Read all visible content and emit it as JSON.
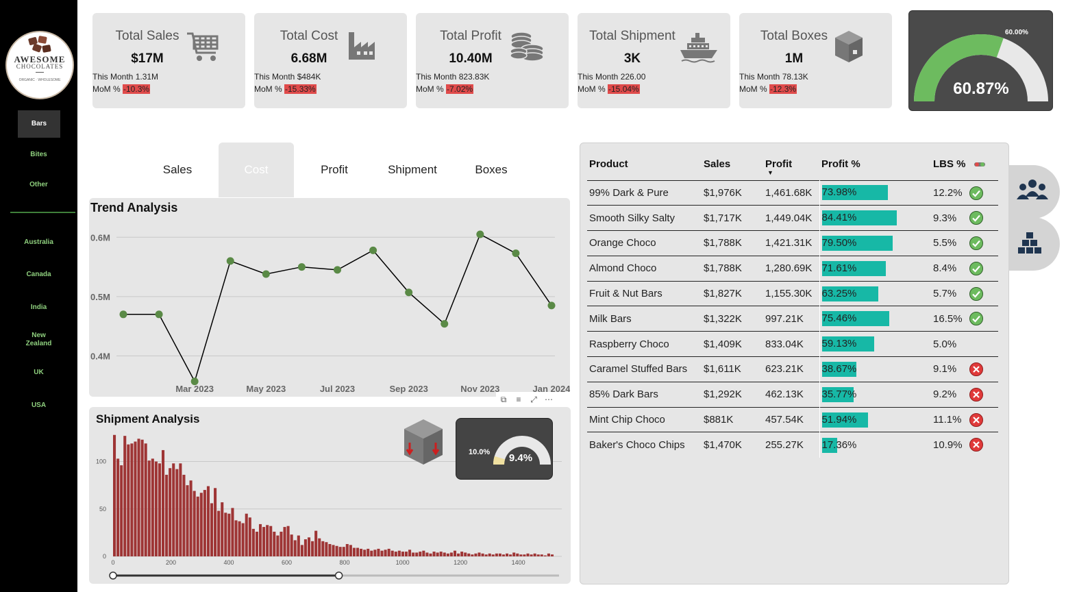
{
  "sidebar": {
    "logo": {
      "title": "AWESOME",
      "subtitle": "CHOCOLATES",
      "tagline": "ORGANIC · WHOLESOME"
    },
    "categories": [
      {
        "label": "Bars",
        "active": true
      },
      {
        "label": "Bites",
        "active": false
      },
      {
        "label": "Other",
        "active": false
      }
    ],
    "countries": [
      "Australia",
      "Canada",
      "India",
      "New Zealand",
      "UK",
      "USA"
    ]
  },
  "kpis": [
    {
      "label": "Total Sales",
      "value": "$17M",
      "month": "This Month 1.31M",
      "mom_label": "MoM %",
      "mom": "-10.3%",
      "icon": "shopping-cart-icon"
    },
    {
      "label": "Total Cost",
      "value": "6.68M",
      "month": "This Month $484K",
      "mom_label": "MoM %",
      "mom": "-15.33%",
      "icon": "factory-icon"
    },
    {
      "label": "Total Profit",
      "value": "10.40M",
      "month": "This Month 823.83K",
      "mom_label": "MoM %",
      "mom": "-7.02%",
      "icon": "coins-icon"
    },
    {
      "label": "Total Shipment",
      "value": "3K",
      "month": "This Month 226.00",
      "mom_label": "MoM %",
      "mom": "-15.04%",
      "icon": "ship-icon"
    },
    {
      "label": "Total Boxes",
      "value": "1M",
      "month": "This Month 78.13K",
      "mom_label": "MoM %",
      "mom": "-12.3%",
      "icon": "box-icon"
    }
  ],
  "profit_gauge": {
    "value_text": "60.87%",
    "target_text": "60.00%",
    "value": 0.6087,
    "target": 0.6
  },
  "tabs": [
    {
      "label": "Sales",
      "active": false
    },
    {
      "label": "Cost",
      "active": true
    },
    {
      "label": "Profit",
      "active": false
    },
    {
      "label": "Shipment",
      "active": false
    },
    {
      "label": "Boxes",
      "active": false
    }
  ],
  "visual_tools": [
    "⧉",
    "≡",
    "⤢",
    "⋯"
  ],
  "chart_data": [
    {
      "type": "line",
      "title": "Trend Analysis",
      "x": [
        "2023-01",
        "2023-02",
        "2023-03",
        "2023-04",
        "2023-05",
        "2023-06",
        "2023-07",
        "2023-08",
        "2023-09",
        "2023-10",
        "2023-11",
        "2023-12",
        "2024-01",
        "2024-02"
      ],
      "values": [
        0.47,
        0.47,
        0.357,
        0.56,
        0.538,
        0.55,
        0.545,
        0.578,
        0.507,
        0.454,
        0.605,
        0.573,
        0.485
      ],
      "x_ticks": [
        "Mar 2023",
        "May 2023",
        "Jul 2023",
        "Sep 2023",
        "Nov 2023",
        "Jan 2024"
      ],
      "y_ticks": [
        "0.4M",
        "0.5M",
        "0.6M"
      ],
      "ylim": [
        0.36,
        0.62
      ],
      "grid": true,
      "color": "#5a8a46"
    },
    {
      "type": "bar",
      "title": "Shipment Analysis",
      "x_ticks": [
        "0",
        "200",
        "400",
        "600",
        "800",
        "1000",
        "1200",
        "1400"
      ],
      "y_ticks": [
        "0",
        "50",
        "100"
      ],
      "xlim": [
        0,
        1550
      ],
      "ylim": [
        0,
        130
      ],
      "bin_width": 12,
      "values": [
        128,
        103,
        96,
        127,
        118,
        119,
        121,
        124,
        123,
        119,
        101,
        103,
        100,
        98,
        112,
        86,
        93,
        98,
        92,
        98,
        86,
        75,
        80,
        69,
        63,
        67,
        70,
        74,
        56,
        72,
        48,
        57,
        46,
        45,
        51,
        38,
        37,
        35,
        45,
        41,
        29,
        26,
        34,
        31,
        33,
        32,
        26,
        22,
        26,
        31,
        32,
        23,
        17,
        22,
        12,
        18,
        20,
        16,
        27,
        19,
        16,
        15,
        13,
        12,
        11,
        10,
        10,
        13,
        12,
        9,
        9,
        8,
        7,
        8,
        6,
        7,
        8,
        6,
        7,
        8,
        6,
        5,
        6,
        5,
        5,
        7,
        4,
        4,
        5,
        6,
        4,
        3,
        5,
        4,
        5,
        4,
        3,
        4,
        6,
        3,
        5,
        4,
        3,
        2,
        3,
        4,
        3,
        2,
        3,
        2,
        3,
        3,
        2,
        3,
        2,
        4,
        3,
        2,
        2,
        3,
        2,
        3,
        2,
        2,
        1,
        3,
        2
      ],
      "color": "#9e3535",
      "slider": {
        "from": 0,
        "to": 780
      }
    }
  ],
  "shipment_gauge": {
    "value_text": "9.4%",
    "target_text": "10.0%",
    "value": 0.094,
    "target": 0.1
  },
  "table": {
    "columns": [
      "Product",
      "Sales",
      "Profit",
      "Profit %",
      "LBS %"
    ],
    "rows": [
      {
        "product": "99% Dark & Pure",
        "sales": "$1,976K",
        "profit": "1,461.68K",
        "profit_pct": "73.98%",
        "pct": 73.98,
        "lbs": "12.2%",
        "status": "ok"
      },
      {
        "product": "Smooth Silky Salty",
        "sales": "$1,717K",
        "profit": "1,449.04K",
        "profit_pct": "84.41%",
        "pct": 84.41,
        "lbs": "9.3%",
        "status": "ok"
      },
      {
        "product": "Orange Choco",
        "sales": "$1,788K",
        "profit": "1,421.31K",
        "profit_pct": "79.50%",
        "pct": 79.5,
        "lbs": "5.5%",
        "status": "ok"
      },
      {
        "product": "Almond Choco",
        "sales": "$1,788K",
        "profit": "1,280.69K",
        "profit_pct": "71.61%",
        "pct": 71.61,
        "lbs": "8.4%",
        "status": "ok"
      },
      {
        "product": "Fruit & Nut Bars",
        "sales": "$1,827K",
        "profit": "1,155.30K",
        "profit_pct": "63.25%",
        "pct": 63.25,
        "lbs": "5.7%",
        "status": "ok"
      },
      {
        "product": "Milk Bars",
        "sales": "$1,322K",
        "profit": "997.21K",
        "profit_pct": "75.46%",
        "pct": 75.46,
        "lbs": "16.5%",
        "status": "ok"
      },
      {
        "product": "Raspberry Choco",
        "sales": "$1,409K",
        "profit": "833.04K",
        "profit_pct": "59.13%",
        "pct": 59.13,
        "lbs": "5.0%",
        "status": "none"
      },
      {
        "product": "Caramel Stuffed Bars",
        "sales": "$1,611K",
        "profit": "623.21K",
        "profit_pct": "38.67%",
        "pct": 38.67,
        "lbs": "9.1%",
        "status": "bad"
      },
      {
        "product": "85% Dark Bars",
        "sales": "$1,292K",
        "profit": "462.13K",
        "profit_pct": "35.77%",
        "pct": 35.77,
        "lbs": "9.2%",
        "status": "bad"
      },
      {
        "product": "Mint Chip Choco",
        "sales": "$881K",
        "profit": "457.54K",
        "profit_pct": "51.94%",
        "pct": 51.94,
        "lbs": "11.1%",
        "status": "bad"
      },
      {
        "product": "Baker's Choco Chips",
        "sales": "$1,470K",
        "profit": "255.27K",
        "profit_pct": "17.36%",
        "pct": 17.36,
        "lbs": "10.9%",
        "status": "bad"
      }
    ]
  },
  "side_buttons": [
    {
      "icon": "people-group-icon"
    },
    {
      "icon": "stacked-boxes-icon"
    }
  ],
  "colors": {
    "accent_green": "#6dbb5f",
    "negative": "#e04b4b",
    "teal_bar": "#17b8a6",
    "hist_bar": "#9e3535",
    "line_point": "#5a8a46"
  }
}
